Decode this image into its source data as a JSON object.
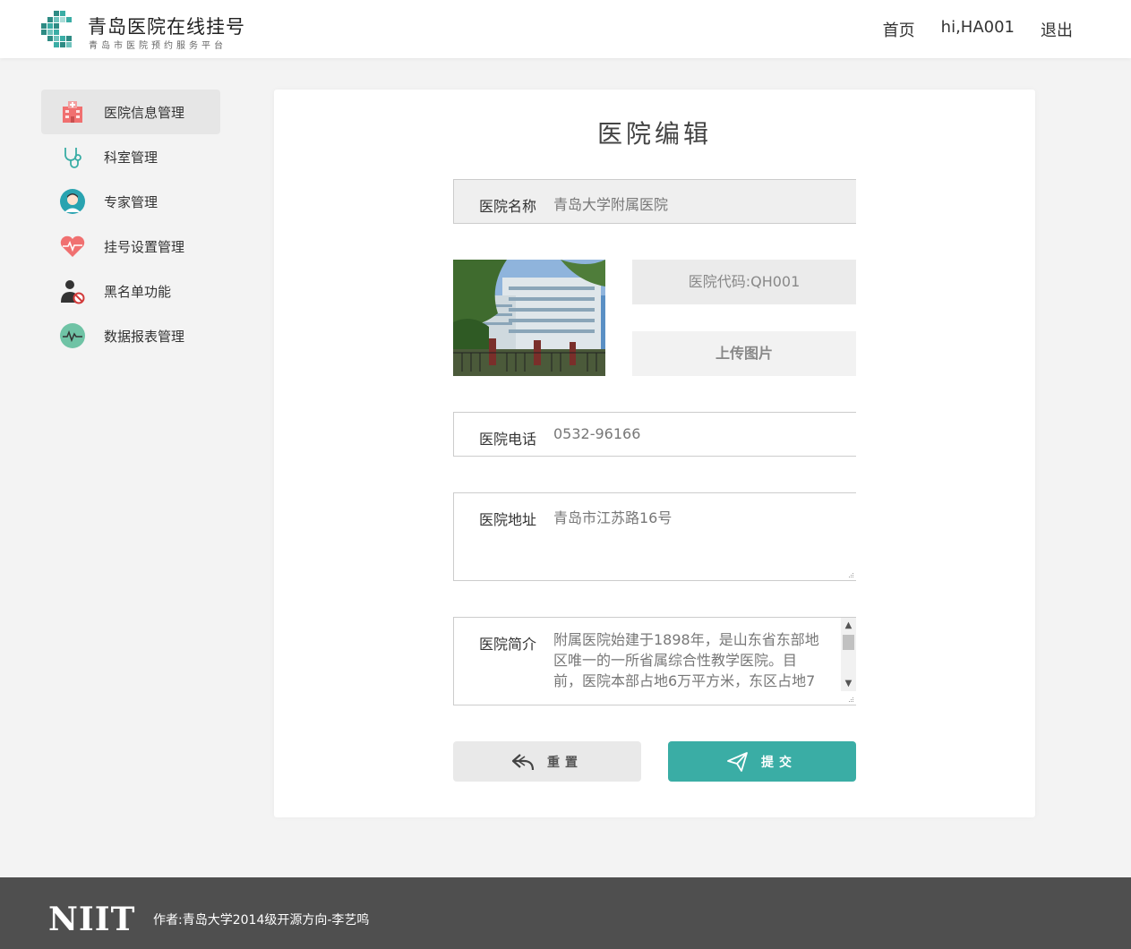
{
  "header": {
    "logo_title": "青岛医院在线挂号",
    "logo_subtitle": "青岛市医院预约服务平台",
    "nav": [
      "首页",
      "hi,HA001",
      "退出"
    ]
  },
  "sidebar": {
    "items": [
      {
        "label": "医院信息管理",
        "icon": "hospital-building-icon",
        "active": true
      },
      {
        "label": "科室管理",
        "icon": "stethoscope-icon",
        "active": false
      },
      {
        "label": "专家管理",
        "icon": "doctor-avatar-icon",
        "active": false
      },
      {
        "label": "挂号设置管理",
        "icon": "heart-pulse-icon",
        "active": false
      },
      {
        "label": "黑名单功能",
        "icon": "user-blocked-icon",
        "active": false
      },
      {
        "label": "数据报表管理",
        "icon": "chart-wave-icon",
        "active": false
      }
    ]
  },
  "form": {
    "title": "医院编辑",
    "name_label": "医院名称",
    "name_value": "青岛大学附属医院",
    "code_text": "医院代码:QH001",
    "upload_label": "上传图片",
    "phone_label": "医院电话",
    "phone_value": "0532-96166",
    "address_label": "医院地址",
    "address_value": "青岛市江苏路16号",
    "intro_label": "医院简介",
    "intro_value": "附属医院始建于1898年，是山东省东部地区唯一的一所省属综合性教学医院。目前，医院本部占地6万平方米，东区占地7",
    "reset_label": "重置",
    "submit_label": "提交"
  },
  "colors": {
    "accent": "#3aada5",
    "footer_bg": "#4f4f4f",
    "page_bg": "#f3f3f3"
  },
  "footer": {
    "logo": "NIIT",
    "text": "作者:青岛大学2014级开源方向-李艺鸣"
  }
}
